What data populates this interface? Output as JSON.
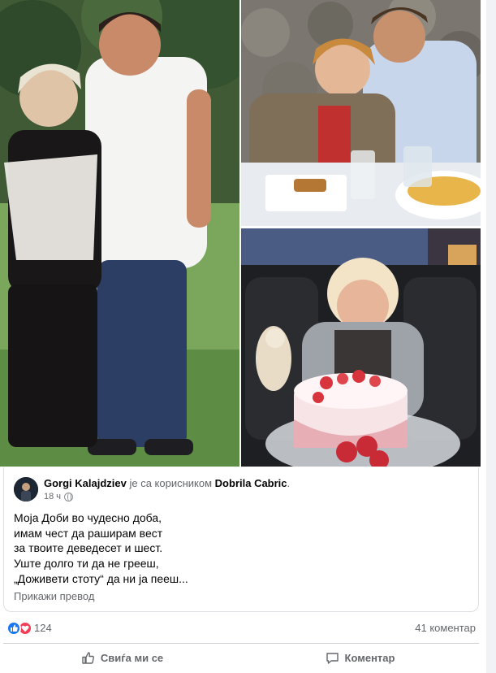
{
  "post": {
    "author": "Gorgi Kalajdziev",
    "with_text": " је са корисником ",
    "tagged_user": "Dobrila Cabric",
    "tagged_end": ".",
    "time": "18 ч",
    "privacy_icon": "globe-icon",
    "text_lines": [
      "Моја Доби во чудесно доба,",
      "имам чест да раширам вест",
      "за твоите деведесет и шест.",
      "Уште долго ти да не грееш,",
      "„Доживети стоту“ да ни ја пееш..."
    ],
    "see_translation": "Прикажи превод"
  },
  "photos": [
    {
      "alt": "couple-standing-outdoors"
    },
    {
      "alt": "couple-at-dinner-table"
    },
    {
      "alt": "woman-with-birthday-cake"
    }
  ],
  "reactions": {
    "icons": [
      "like-icon",
      "love-icon"
    ],
    "count": "124",
    "comments": "41 коментар"
  },
  "actions": {
    "like_label": "Свиѓа ми се",
    "comment_label": "Коментар"
  },
  "colors": {
    "like_blue": "#1877f2",
    "love_red": "#f33e58",
    "secondary_text": "#65676b"
  }
}
